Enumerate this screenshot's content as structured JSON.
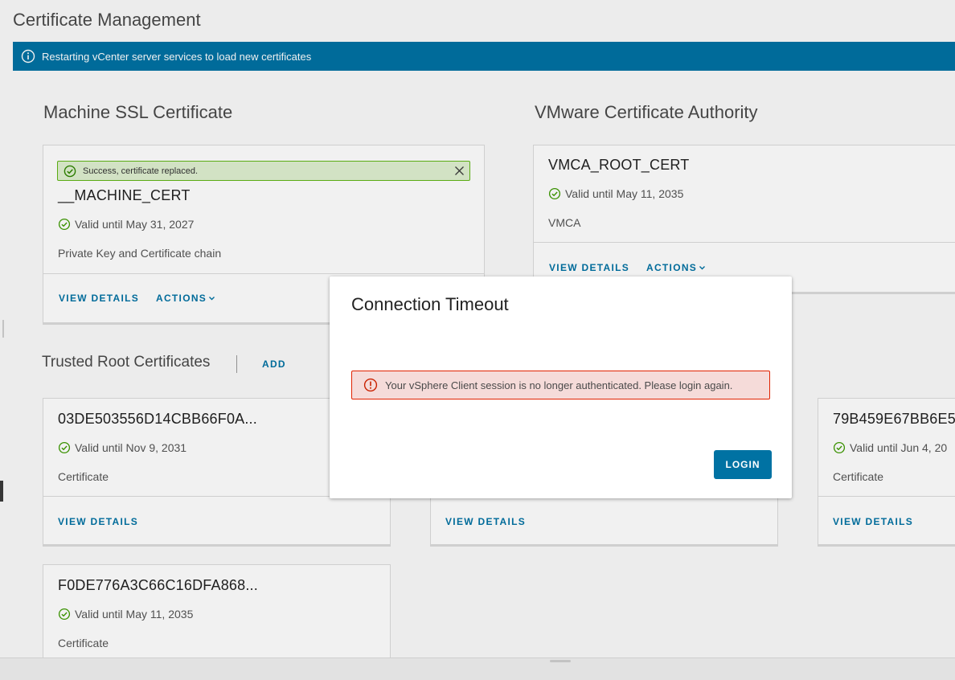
{
  "page": {
    "title": "Certificate Management"
  },
  "banner": {
    "text": "Restarting vCenter server services to load new certificates",
    "icon": "info-icon",
    "color": "#0072a3"
  },
  "machine_ssl": {
    "title": "Machine SSL Certificate",
    "alert": "Success, certificate replaced.",
    "name": "__MACHINE_CERT",
    "valid": "Valid until May 31, 2027",
    "type": "Private Key and Certificate chain",
    "view_details": "VIEW DETAILS",
    "actions": "ACTIONS"
  },
  "vmca": {
    "title": "VMware Certificate Authority",
    "name": "VMCA_ROOT_CERT",
    "valid": "Valid until May 11, 2035",
    "type": "VMCA",
    "view_details": "VIEW DETAILS",
    "actions": "ACTIONS"
  },
  "trusted": {
    "title": "Trusted Root Certificates",
    "add": "ADD",
    "cards": [
      {
        "name": "03DE503556D14CBB66F0A...",
        "valid": "Valid until Nov 9, 2031",
        "type": "Certificate",
        "view_details": "VIEW DETAILS"
      },
      {
        "view_details": "VIEW DETAILS"
      },
      {
        "name": "79B459E67BB6E5",
        "valid": "Valid until Jun 4, 20",
        "type": "Certificate",
        "view_details": "VIEW DETAILS"
      },
      {
        "name": "F0DE776A3C66C16DFA868...",
        "valid": "Valid until May 11, 2035",
        "type": "Certificate"
      }
    ]
  },
  "modal": {
    "title": "Connection Timeout",
    "error": "Your vSphere Client session is no longer authenticated. Please login again.",
    "login": "LOGIN"
  },
  "colors": {
    "accent": "#0072a3",
    "success_border": "#60b515",
    "error_border": "#e12200"
  }
}
